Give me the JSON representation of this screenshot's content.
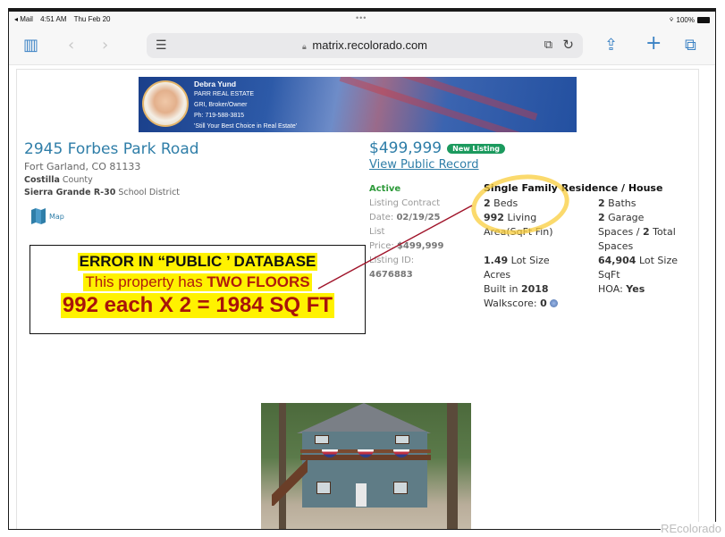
{
  "statusbar": {
    "back_app": "◂ Mail",
    "time": "4:51 AM",
    "date": "Thu Feb 20",
    "dots": "•••",
    "battery": "100%"
  },
  "browser": {
    "url": "matrix.recolorado.com"
  },
  "banner": {
    "agent_name": "Debra Yund",
    "brokerage": "PARR REAL ESTATE",
    "title": "GRI, Broker/Owner",
    "phone": "Ph: 719-588-3815",
    "tagline": "'Still Your Best Choice in Real Estate'"
  },
  "listing": {
    "street": "2945 Forbes Park Road",
    "city_state_zip": "Fort Garland, CO 81133",
    "county_name": "Costilla",
    "county_label": " County",
    "district_name": "Sierra Grande R-30",
    "district_label": " School District",
    "map_label": "Map",
    "price": "$499,999",
    "badge": "New Listing",
    "public_record_link": "View Public Record",
    "status": "Active",
    "contract_label_1": "Listing Contract",
    "contract_label_2": "Date: ",
    "contract_date": "02/19/25",
    "list_price_label_1": "List",
    "list_price_label_2": "Price: ",
    "list_price": "$499,999",
    "listing_id_label": "Listing ID:",
    "listing_id": "4676883",
    "property_type": "Single Family Residence / House",
    "beds_value": "2",
    "beds_label": " Beds",
    "living_value": "992",
    "living_label_1": " Living",
    "living_label_2": "Area(SqFt Fin)",
    "lot_acres_value": "1.49",
    "lot_acres_label_1": " Lot Size",
    "lot_acres_label_2": "Acres",
    "built_label": "Built in ",
    "built_value": "2018",
    "walkscore_label": "Walkscore: ",
    "walkscore_value": "0",
    "baths_value": "2",
    "baths_label": " Baths",
    "garage_value": "2",
    "garage_label_1": " Garage",
    "garage_label_2": "Spaces / ",
    "total_spaces_value": "2",
    "total_spaces_label_1": " Total",
    "total_spaces_label_2": "Spaces",
    "lot_sqft_value": "64,904",
    "lot_sqft_label_1": " Lot Size",
    "lot_sqft_label_2": "SqFt",
    "hoa_label": "HOA: ",
    "hoa_value": "Yes"
  },
  "annotation": {
    "line1": "ERROR IN “PUBLIC ’ DATABASE",
    "line2_prefix": "This property has ",
    "line2_bold": "TWO FLOORS",
    "line3": "992 each X 2 = 1984 SQ FT",
    "highlight_color": "#fff200",
    "text_color": "#b01c0c"
  },
  "watermark": "REcolorado"
}
